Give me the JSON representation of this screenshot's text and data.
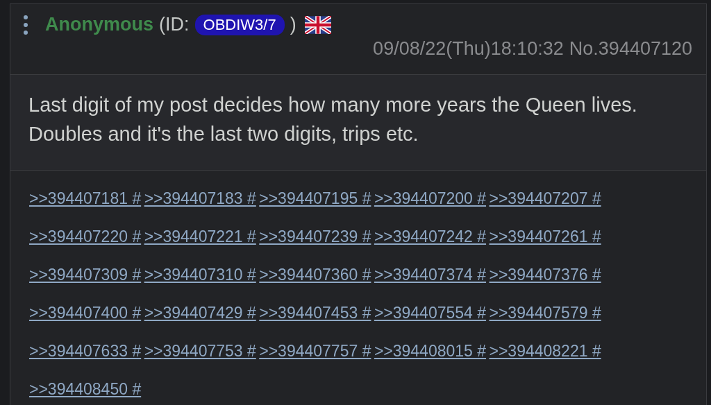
{
  "post": {
    "name": "Anonymous",
    "id_prefix": "(ID:",
    "id": "OBDIW3/7",
    "id_suffix": ")",
    "date": "09/08/22(Thu)18:10:32",
    "number": "No.394407120",
    "message": "Last digit of my post decides how many more years the Queen lives. Doubles and it's the last two digits, trips etc.",
    "replies": [
      ">>394407181 #",
      ">>394407183 #",
      ">>394407195 #",
      ">>394407200 #",
      ">>394407207 #",
      ">>394407220 #",
      ">>394407221 #",
      ">>394407239 #",
      ">>394407242 #",
      ">>394407261 #",
      ">>394407309 #",
      ">>394407310 #",
      ">>394407360 #",
      ">>394407374 #",
      ">>394407376 #",
      ">>394407400 #",
      ">>394407429 #",
      ">>394407453 #",
      ">>394407554 #",
      ">>394407579 #",
      ">>394407633 #",
      ">>394407753 #",
      ">>394407757 #",
      ">>394408015 #",
      ">>394408221 #",
      ">>394408450 #"
    ]
  }
}
